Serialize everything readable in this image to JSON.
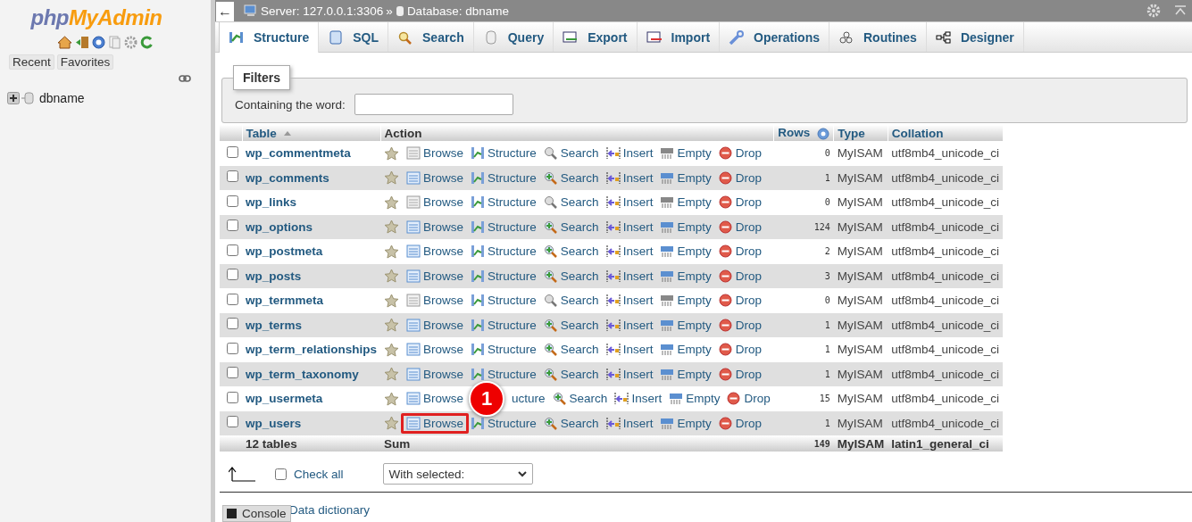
{
  "sidebar": {
    "logo_php": "php",
    "logo_rest": "MyAdmin",
    "tabs": [
      "Recent",
      "Favorites"
    ],
    "tree": [
      {
        "label": "dbname",
        "expanded": false
      }
    ]
  },
  "breadcrumb": {
    "back": "←",
    "server": "Server: 127.0.0.1:3306",
    "sep": "»",
    "database": "Database: dbname"
  },
  "tabs": [
    {
      "label": "Structure",
      "selected": true
    },
    {
      "label": "SQL",
      "selected": false
    },
    {
      "label": "Search",
      "selected": false
    },
    {
      "label": "Query",
      "selected": false
    },
    {
      "label": "Export",
      "selected": false
    },
    {
      "label": "Import",
      "selected": false
    },
    {
      "label": "Operations",
      "selected": false
    },
    {
      "label": "Routines",
      "selected": false
    },
    {
      "label": "Designer",
      "selected": false
    }
  ],
  "filters": {
    "legend": "Filters",
    "label": "Containing the word:"
  },
  "table": {
    "columns": [
      "Table",
      "Action",
      "Rows",
      "Type",
      "Collation"
    ],
    "rows": [
      {
        "name": "wp_commentmeta",
        "actions": [
          "Browse",
          "Structure",
          "Search",
          "Insert",
          "Empty",
          "Drop"
        ],
        "rows": "0",
        "type": "MyISAM",
        "collation": "utf8mb4_unicode_ci",
        "checked": false,
        "empty": true,
        "highlighted": false
      },
      {
        "name": "wp_comments",
        "actions": [
          "Browse",
          "Structure",
          "Search",
          "Insert",
          "Empty",
          "Drop"
        ],
        "rows": "1",
        "type": "MyISAM",
        "collation": "utf8mb4_unicode_ci",
        "checked": false,
        "empty": false,
        "highlighted": false
      },
      {
        "name": "wp_links",
        "actions": [
          "Browse",
          "Structure",
          "Search",
          "Insert",
          "Empty",
          "Drop"
        ],
        "rows": "0",
        "type": "MyISAM",
        "collation": "utf8mb4_unicode_ci",
        "checked": false,
        "empty": true,
        "highlighted": false
      },
      {
        "name": "wp_options",
        "actions": [
          "Browse",
          "Structure",
          "Search",
          "Insert",
          "Empty",
          "Drop"
        ],
        "rows": "124",
        "type": "MyISAM",
        "collation": "utf8mb4_unicode_ci",
        "checked": false,
        "empty": false,
        "highlighted": false
      },
      {
        "name": "wp_postmeta",
        "actions": [
          "Browse",
          "Structure",
          "Search",
          "Insert",
          "Empty",
          "Drop"
        ],
        "rows": "2",
        "type": "MyISAM",
        "collation": "utf8mb4_unicode_ci",
        "checked": false,
        "empty": false,
        "highlighted": false
      },
      {
        "name": "wp_posts",
        "actions": [
          "Browse",
          "Structure",
          "Search",
          "Insert",
          "Empty",
          "Drop"
        ],
        "rows": "3",
        "type": "MyISAM",
        "collation": "utf8mb4_unicode_ci",
        "checked": false,
        "empty": false,
        "highlighted": false
      },
      {
        "name": "wp_termmeta",
        "actions": [
          "Browse",
          "Structure",
          "Search",
          "Insert",
          "Empty",
          "Drop"
        ],
        "rows": "0",
        "type": "MyISAM",
        "collation": "utf8mb4_unicode_ci",
        "checked": false,
        "empty": true,
        "highlighted": false
      },
      {
        "name": "wp_terms",
        "actions": [
          "Browse",
          "Structure",
          "Search",
          "Insert",
          "Empty",
          "Drop"
        ],
        "rows": "1",
        "type": "MyISAM",
        "collation": "utf8mb4_unicode_ci",
        "checked": false,
        "empty": false,
        "highlighted": false
      },
      {
        "name": "wp_term_relationships",
        "actions": [
          "Browse",
          "Structure",
          "Search",
          "Insert",
          "Empty",
          "Drop"
        ],
        "rows": "1",
        "type": "MyISAM",
        "collation": "utf8mb4_unicode_ci",
        "checked": false,
        "empty": false,
        "highlighted": false
      },
      {
        "name": "wp_term_taxonomy",
        "actions": [
          "Browse",
          "Structure",
          "Search",
          "Insert",
          "Empty",
          "Drop"
        ],
        "rows": "1",
        "type": "MyISAM",
        "collation": "utf8mb4_unicode_ci",
        "checked": false,
        "empty": false,
        "highlighted": false
      },
      {
        "name": "wp_usermeta",
        "actions": [
          "Browse",
          "ucture",
          "Search",
          "Insert",
          "Empty",
          "Drop"
        ],
        "rows": "15",
        "type": "MyISAM",
        "collation": "utf8mb4_unicode_ci",
        "checked": false,
        "empty": false,
        "highlighted": false,
        "callout": "1"
      },
      {
        "name": "wp_users",
        "actions": [
          "Browse",
          "Structure",
          "Search",
          "Insert",
          "Empty",
          "Drop"
        ],
        "rows": "1",
        "type": "MyISAM",
        "collation": "utf8mb4_unicode_ci",
        "checked": false,
        "empty": false,
        "highlighted": true
      }
    ],
    "footer": {
      "count": "12 tables",
      "sum": "Sum",
      "rows": "149",
      "type": "MyISAM",
      "collation": "latin1_general_ci"
    }
  },
  "bulk": {
    "check_all": "Check all",
    "checked": false,
    "with_selected": "With selected:"
  },
  "bottom": {
    "data_dictionary": "Data dictionary",
    "console": "Console"
  }
}
